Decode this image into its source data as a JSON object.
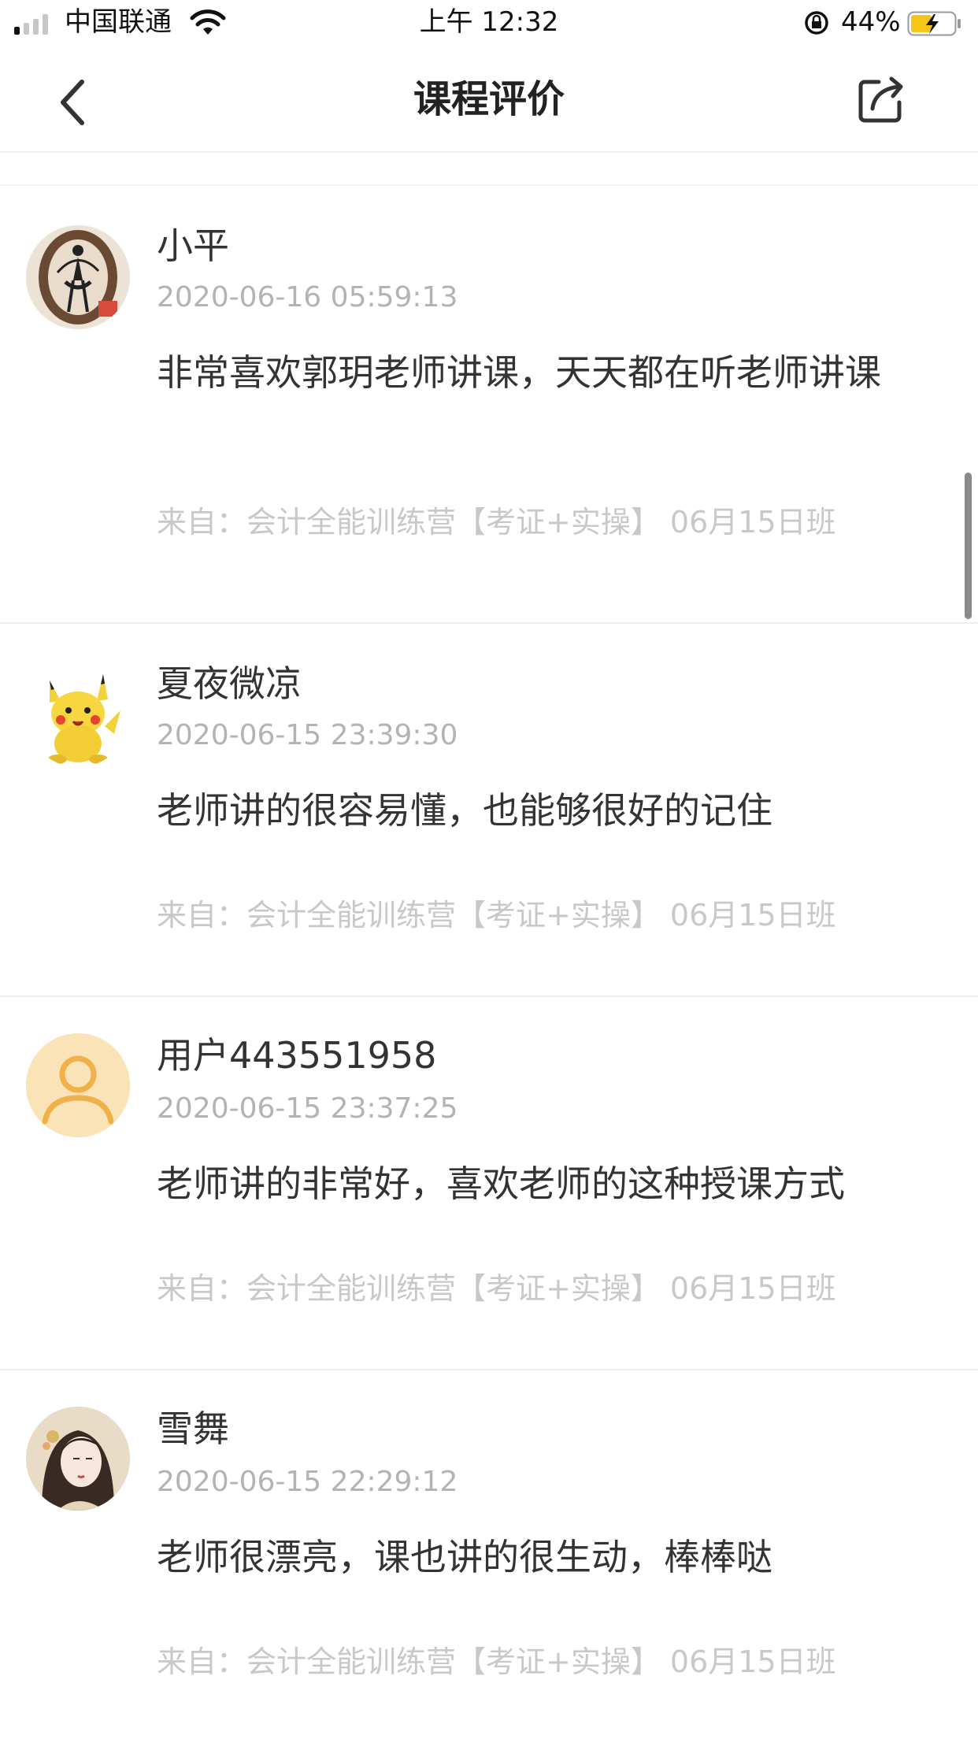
{
  "status_bar": {
    "carrier": "中国联通",
    "time": "上午 12:32",
    "battery_percent": "44%"
  },
  "nav": {
    "title": "课程评价",
    "back_icon": "chevron-left-icon",
    "share_icon": "share-icon"
  },
  "reviews": [
    {
      "username": "小平",
      "timestamp": "2020-06-16 05:59:13",
      "comment": "非常喜欢郭玥老师讲课，天天都在听老师讲课",
      "source": "来自：会计全能训练营【考证+实操】 06月15日班"
    },
    {
      "username": "夏夜微凉",
      "timestamp": "2020-06-15 23:39:30",
      "comment": "老师讲的很容易懂，也能够很好的记住",
      "source": "来自：会计全能训练营【考证+实操】 06月15日班"
    },
    {
      "username": "用户443551958",
      "timestamp": "2020-06-15 23:37:25",
      "comment": "老师讲的非常好，喜欢老师的这种授课方式",
      "source": "来自：会计全能训练营【考证+实操】 06月15日班"
    },
    {
      "username": "雪舞",
      "timestamp": "2020-06-15 22:29:12",
      "comment": "老师很漂亮，课也讲的很生动，棒棒哒",
      "source": "来自：会计全能训练营【考证+实操】 06月15日班"
    }
  ],
  "colors": {
    "battery_fill": "#f5c518",
    "default_avatar_bg": "#fbe3b8",
    "default_avatar_fg": "#f0b04a"
  }
}
